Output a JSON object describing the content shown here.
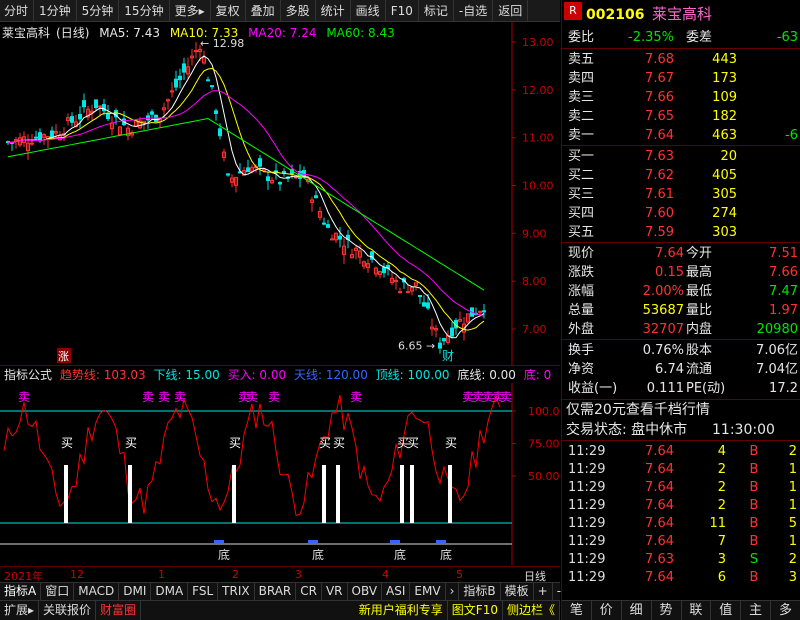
{
  "toolbar": {
    "items": [
      "分时",
      "1分钟",
      "5分钟",
      "15分钟",
      "更多▸",
      "复权",
      "叠加",
      "多股",
      "统计",
      "画线",
      "F10",
      "标记",
      "-自选",
      "返回"
    ]
  },
  "legend": {
    "name": "莱宝高科",
    "period": "(日线)",
    "ma5": "MA5: 7.43",
    "ma10": "MA10: 7.33",
    "ma20": "MA20: 7.24",
    "ma60": "MA60: 8.43"
  },
  "price_axis": [
    "13.00",
    "12.00",
    "11.00",
    "10.00",
    "9.00",
    "8.00",
    "7.00"
  ],
  "annotations": {
    "high": "12.98",
    "low": "6.65",
    "buy_marker": "财",
    "up_marker": "涨"
  },
  "indicator": {
    "name": "指标公式",
    "trend": "趋势线: 103.03",
    "low_line": "下线: 15.00",
    "buy_in": "买入: 0.00",
    "sky": "天线: 120.00",
    "top": "顶线: 100.00",
    "bottom": "底线: 0.00",
    "bottom2": "底: 0",
    "axis": [
      "100.0",
      "75.00",
      "50.00"
    ],
    "sell_label": "卖",
    "buy_label": "买",
    "bottom_label": "底"
  },
  "timeline": {
    "labels": [
      "2021年",
      "12",
      "1",
      "2",
      "3",
      "4",
      "5"
    ],
    "period": "日线"
  },
  "tabs": [
    "指标A",
    "窗口",
    "MACD",
    "DMI",
    "DMA",
    "FSL",
    "TRIX",
    "BRAR",
    "CR",
    "VR",
    "OBV",
    "ASI",
    "EMV",
    "›",
    "指标B",
    "模板",
    "+",
    "-"
  ],
  "bottom": {
    "left": [
      "扩展▸",
      "关联报价",
      "财富圈"
    ],
    "right": [
      "新用户福利专享",
      "图文F10",
      "侧边栏《"
    ]
  },
  "stock": {
    "code": "002106",
    "name": "莱宝高科",
    "flag": "R",
    "weibi_label": "委比",
    "weibi": "-2.35%",
    "weicha_label": "委差",
    "weicha": "-63"
  },
  "asks": [
    {
      "label": "卖五",
      "price": "7.68",
      "vol": "443",
      "extra": ""
    },
    {
      "label": "卖四",
      "price": "7.67",
      "vol": "173",
      "extra": ""
    },
    {
      "label": "卖三",
      "price": "7.66",
      "vol": "109",
      "extra": ""
    },
    {
      "label": "卖二",
      "price": "7.65",
      "vol": "182",
      "extra": ""
    },
    {
      "label": "卖一",
      "price": "7.64",
      "vol": "463",
      "extra": "-6"
    }
  ],
  "bids": [
    {
      "label": "买一",
      "price": "7.63",
      "vol": "20",
      "extra": ""
    },
    {
      "label": "买二",
      "price": "7.62",
      "vol": "405",
      "extra": ""
    },
    {
      "label": "买三",
      "price": "7.61",
      "vol": "305",
      "extra": ""
    },
    {
      "label": "买四",
      "price": "7.60",
      "vol": "274",
      "extra": ""
    },
    {
      "label": "买五",
      "price": "7.59",
      "vol": "303",
      "extra": ""
    }
  ],
  "quote": [
    {
      "l1": "现价",
      "v1": "7.64",
      "c1": "red",
      "l2": "今开",
      "v2": "7.51",
      "c2": "red"
    },
    {
      "l1": "涨跌",
      "v1": "0.15",
      "c1": "red",
      "l2": "最高",
      "v2": "7.66",
      "c2": "red"
    },
    {
      "l1": "涨幅",
      "v1": "2.00%",
      "c1": "red",
      "l2": "最低",
      "v2": "7.47",
      "c2": "grn"
    },
    {
      "l1": "总量",
      "v1": "53687",
      "c1": "yel",
      "l2": "量比",
      "v2": "1.97",
      "c2": "red"
    },
    {
      "l1": "外盘",
      "v1": "32707",
      "c1": "red",
      "l2": "内盘",
      "v2": "20980",
      "c2": "grn"
    }
  ],
  "fundamentals": [
    {
      "l1": "换手",
      "v1": "0.76%",
      "l2": "股本",
      "v2": "7.06亿"
    },
    {
      "l1": "净资",
      "v1": "6.74",
      "l2": "流通",
      "v2": "7.04亿"
    },
    {
      "l1": "收益(一)",
      "v1": "0.111",
      "l2": "PE(动)",
      "v2": "17.2"
    }
  ],
  "promo": "仅需20元查看千档行情",
  "status": {
    "label": "交易状态: 盘中休市",
    "time": "11:30:00"
  },
  "ticks": [
    {
      "time": "11:29",
      "price": "7.64",
      "vol": "4",
      "side": "B",
      "n": "2"
    },
    {
      "time": "11:29",
      "price": "7.64",
      "vol": "2",
      "side": "B",
      "n": "1"
    },
    {
      "time": "11:29",
      "price": "7.64",
      "vol": "2",
      "side": "B",
      "n": "1"
    },
    {
      "time": "11:29",
      "price": "7.64",
      "vol": "2",
      "side": "B",
      "n": "1"
    },
    {
      "time": "11:29",
      "price": "7.64",
      "vol": "11",
      "side": "B",
      "n": "5"
    },
    {
      "time": "11:29",
      "price": "7.64",
      "vol": "7",
      "side": "B",
      "n": "1"
    },
    {
      "time": "11:29",
      "price": "7.63",
      "vol": "3",
      "side": "S",
      "n": "2"
    },
    {
      "time": "11:29",
      "price": "7.64",
      "vol": "6",
      "side": "B",
      "n": "3"
    }
  ],
  "rtabs": [
    "笔",
    "价",
    "细",
    "势",
    "联",
    "值",
    "主",
    "多"
  ],
  "colors": {
    "up": "#ff3232",
    "down": "#00e5e5",
    "ma5": "#ffffff",
    "ma10": "#ffff00",
    "ma20": "#ff00ff",
    "ma60": "#00ff00",
    "trend": "#ff0000",
    "guide": "#00e5e5"
  }
}
